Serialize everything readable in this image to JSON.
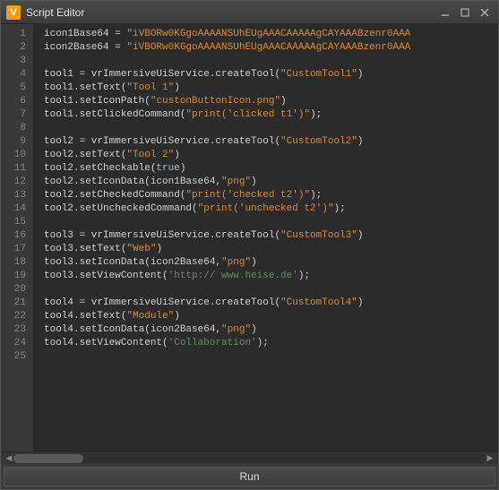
{
  "window": {
    "title": "Script Editor",
    "icon_letter": "V"
  },
  "lines": [
    {
      "n": 1,
      "tokens": [
        {
          "t": "icon1Base64 = ",
          "c": ""
        },
        {
          "t": "\"iVBORw0KGgoAAAANSUhEUgAAACAAAAAgCAYAAABzenr0AAA",
          "c": "str"
        }
      ]
    },
    {
      "n": 2,
      "tokens": [
        {
          "t": "icon2Base64 = ",
          "c": ""
        },
        {
          "t": "\"iVBORw0KGgoAAAANSUhEUgAAACAAAAAgCAYAAABzenr0AAA",
          "c": "str"
        }
      ]
    },
    {
      "n": 3,
      "tokens": []
    },
    {
      "n": 4,
      "tokens": [
        {
          "t": "tool1 = vrImmersiveUiService.createTool(",
          "c": ""
        },
        {
          "t": "\"CustomTool1\"",
          "c": "str"
        },
        {
          "t": ")",
          "c": ""
        }
      ]
    },
    {
      "n": 5,
      "tokens": [
        {
          "t": "tool1.setText(",
          "c": ""
        },
        {
          "t": "\"Tool 1\"",
          "c": "str"
        },
        {
          "t": ")",
          "c": ""
        }
      ]
    },
    {
      "n": 6,
      "tokens": [
        {
          "t": "tool1.setIconPath(",
          "c": ""
        },
        {
          "t": "\"custonButtonIcon.png\"",
          "c": "str"
        },
        {
          "t": ")",
          "c": ""
        }
      ]
    },
    {
      "n": 7,
      "tokens": [
        {
          "t": "tool1.setClickedCommand(",
          "c": ""
        },
        {
          "t": "\"print('clicked t1')\"",
          "c": "str"
        },
        {
          "t": ");",
          "c": ""
        }
      ]
    },
    {
      "n": 8,
      "tokens": []
    },
    {
      "n": 9,
      "tokens": [
        {
          "t": "tool2 = vrImmersiveUiService.createTool(",
          "c": ""
        },
        {
          "t": "\"CustomTool2\"",
          "c": "str"
        },
        {
          "t": ")",
          "c": ""
        }
      ]
    },
    {
      "n": 10,
      "tokens": [
        {
          "t": "tool2.setText(",
          "c": ""
        },
        {
          "t": "\"Tool 2\"",
          "c": "str"
        },
        {
          "t": ")",
          "c": ""
        }
      ]
    },
    {
      "n": 11,
      "tokens": [
        {
          "t": "tool2.setCheckable(",
          "c": ""
        },
        {
          "t": "true",
          "c": "kw"
        },
        {
          "t": ")",
          "c": ""
        }
      ]
    },
    {
      "n": 12,
      "tokens": [
        {
          "t": "tool2.setIconData(icon1Base64,",
          "c": ""
        },
        {
          "t": "\"png\"",
          "c": "str"
        },
        {
          "t": ")",
          "c": ""
        }
      ]
    },
    {
      "n": 13,
      "tokens": [
        {
          "t": "tool2.setCheckedCommand(",
          "c": ""
        },
        {
          "t": "\"print('checked t2')\"",
          "c": "str"
        },
        {
          "t": ");",
          "c": ""
        }
      ]
    },
    {
      "n": 14,
      "tokens": [
        {
          "t": "tool2.setUncheckedCommand(",
          "c": ""
        },
        {
          "t": "\"print('unchecked t2')\"",
          "c": "str"
        },
        {
          "t": ");",
          "c": ""
        }
      ]
    },
    {
      "n": 15,
      "tokens": []
    },
    {
      "n": 16,
      "tokens": [
        {
          "t": "tool3 = vrImmersiveUiService.createTool(",
          "c": ""
        },
        {
          "t": "\"CustomTool3\"",
          "c": "str"
        },
        {
          "t": ")",
          "c": ""
        }
      ]
    },
    {
      "n": 17,
      "tokens": [
        {
          "t": "tool3.setText(",
          "c": ""
        },
        {
          "t": "\"Web\"",
          "c": "str"
        },
        {
          "t": ")",
          "c": ""
        }
      ]
    },
    {
      "n": 18,
      "tokens": [
        {
          "t": "tool3.setIconData(icon2Base64,",
          "c": ""
        },
        {
          "t": "\"png\"",
          "c": "str"
        },
        {
          "t": ")",
          "c": ""
        }
      ]
    },
    {
      "n": 19,
      "tokens": [
        {
          "t": "tool3.setViewContent(",
          "c": ""
        },
        {
          "t": "'http:// www.heise.de'",
          "c": "str2"
        },
        {
          "t": ");",
          "c": ""
        }
      ]
    },
    {
      "n": 20,
      "tokens": []
    },
    {
      "n": 21,
      "tokens": [
        {
          "t": "tool4 = vrImmersiveUiService.createTool(",
          "c": ""
        },
        {
          "t": "\"CustomTool4\"",
          "c": "str"
        },
        {
          "t": ")",
          "c": ""
        }
      ]
    },
    {
      "n": 22,
      "tokens": [
        {
          "t": "tool4.setText(",
          "c": ""
        },
        {
          "t": "\"Module\"",
          "c": "str"
        },
        {
          "t": ")",
          "c": ""
        }
      ]
    },
    {
      "n": 23,
      "tokens": [
        {
          "t": "tool4.setIconData(icon2Base64,",
          "c": ""
        },
        {
          "t": "\"png\"",
          "c": "str"
        },
        {
          "t": ")",
          "c": ""
        }
      ]
    },
    {
      "n": 24,
      "tokens": [
        {
          "t": "tool4.setViewContent(",
          "c": ""
        },
        {
          "t": "'Collaboration'",
          "c": "str2"
        },
        {
          "t": ");",
          "c": ""
        }
      ]
    },
    {
      "n": 25,
      "tokens": []
    }
  ],
  "run_label": "Run"
}
